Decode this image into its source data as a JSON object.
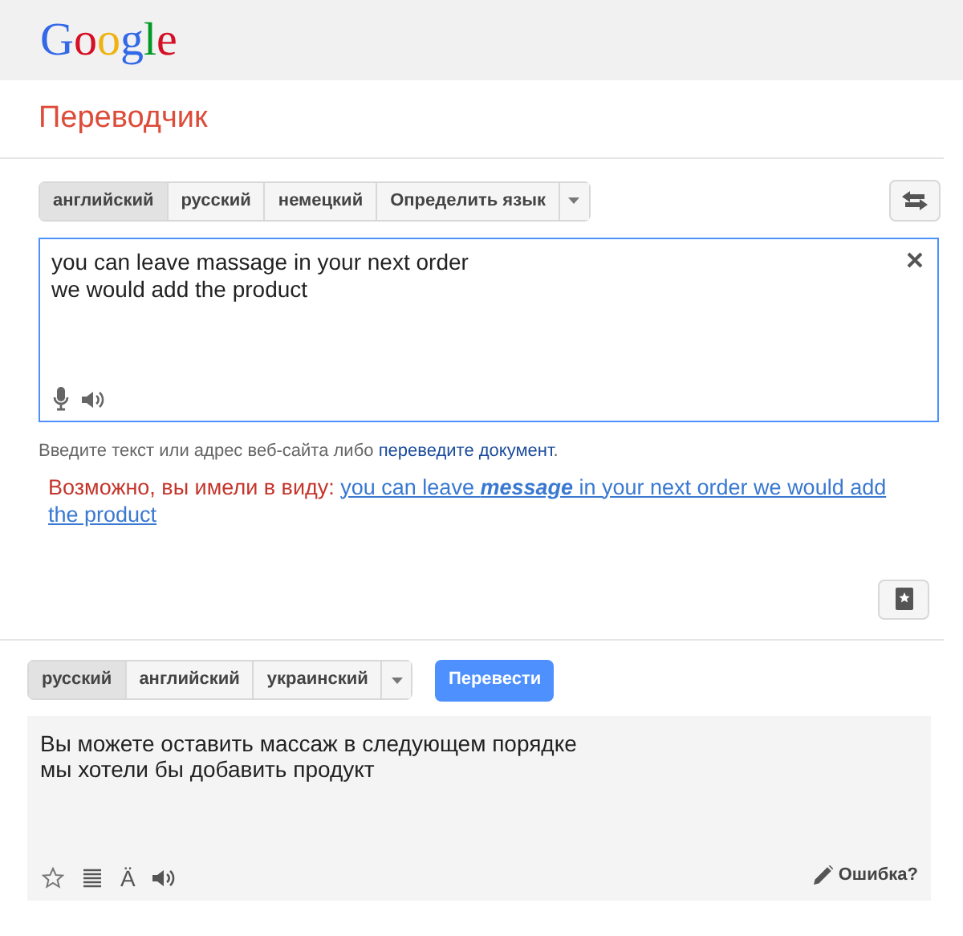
{
  "logo": {
    "letters": [
      {
        "char": "G",
        "color": "#3369e8"
      },
      {
        "char": "o",
        "color": "#d50f25"
      },
      {
        "char": "o",
        "color": "#eeb211"
      },
      {
        "char": "g",
        "color": "#3369e8"
      },
      {
        "char": "l",
        "color": "#009925"
      },
      {
        "char": "e",
        "color": "#d50f25"
      }
    ]
  },
  "title": "Переводчик",
  "source": {
    "tabs": [
      {
        "label": "английский",
        "selected": true
      },
      {
        "label": "русский",
        "selected": false
      },
      {
        "label": "немецкий",
        "selected": false
      },
      {
        "label": "Определить язык",
        "selected": false
      }
    ],
    "value": "you can leave massage in your next order\nwe would add the product",
    "hint": "Введите текст или адрес веб-сайта либо ",
    "hint_link": "переведите документ",
    "hint_end": ".",
    "suggestion_label": "Возможно, вы имели в виду:",
    "suggestion": "you can leave **message** in your next order we would add the product"
  },
  "target": {
    "tabs": [
      {
        "label": "русский",
        "selected": true
      },
      {
        "label": "английский",
        "selected": false
      },
      {
        "label": "украинский",
        "selected": false
      }
    ],
    "translate_button": "Перевести",
    "result": "Вы можете оставить массаж в следующем порядке\nмы хотели бы добавить продукт",
    "transliterate": "Ä",
    "feedback": "Ошибка?"
  }
}
